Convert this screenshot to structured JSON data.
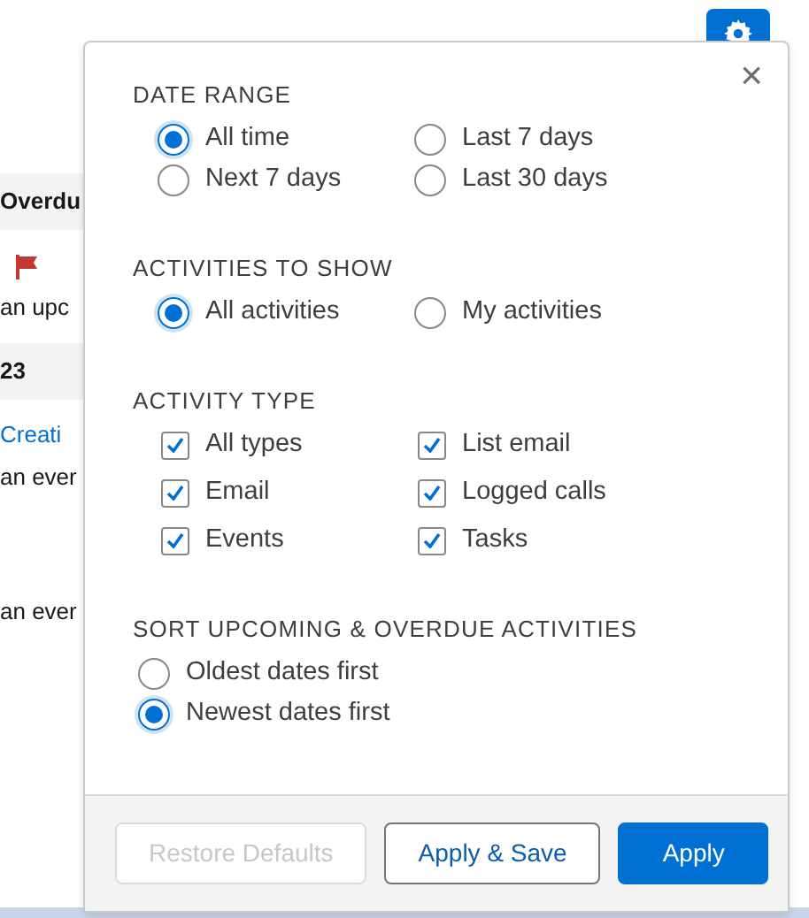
{
  "background": {
    "rows": [
      {
        "kind": "band",
        "text": "Overdu"
      },
      {
        "kind": "flag"
      },
      {
        "kind": "text",
        "text": "an upc"
      },
      {
        "kind": "band",
        "text": "23"
      },
      {
        "kind": "link",
        "text": "Creati"
      },
      {
        "kind": "text",
        "text": "an ever"
      },
      {
        "kind": "gap"
      },
      {
        "kind": "text",
        "text": "an ever"
      }
    ]
  },
  "popover": {
    "close": "×",
    "sections": [
      {
        "title": "DATE RANGE",
        "kind": "radio",
        "options": [
          {
            "label": "All time",
            "selected": true
          },
          {
            "label": "Last 7 days",
            "selected": false
          },
          {
            "label": "Next 7 days",
            "selected": false
          },
          {
            "label": "Last 30 days",
            "selected": false
          }
        ]
      },
      {
        "title": "ACTIVITIES TO SHOW",
        "kind": "radio",
        "options": [
          {
            "label": "All activities",
            "selected": true
          },
          {
            "label": "My activities",
            "selected": false
          }
        ]
      },
      {
        "title": "ACTIVITY TYPE",
        "kind": "checkbox",
        "options": [
          {
            "label": "All types",
            "checked": true
          },
          {
            "label": "List email",
            "checked": true
          },
          {
            "label": "Email",
            "checked": true
          },
          {
            "label": "Logged calls",
            "checked": true
          },
          {
            "label": "Events",
            "checked": true
          },
          {
            "label": "Tasks",
            "checked": true
          }
        ]
      },
      {
        "title": "SORT UPCOMING & OVERDUE ACTIVITIES",
        "kind": "radio-list",
        "options": [
          {
            "label": "Oldest dates first",
            "selected": false
          },
          {
            "label": "Newest dates first",
            "selected": true
          }
        ]
      }
    ],
    "buttons": [
      {
        "label": "Restore Defaults",
        "kind": "neutral",
        "disabled": true
      },
      {
        "label": "Apply & Save",
        "kind": "neutral",
        "disabled": false
      },
      {
        "label": "Apply",
        "kind": "brand",
        "disabled": false
      }
    ]
  }
}
